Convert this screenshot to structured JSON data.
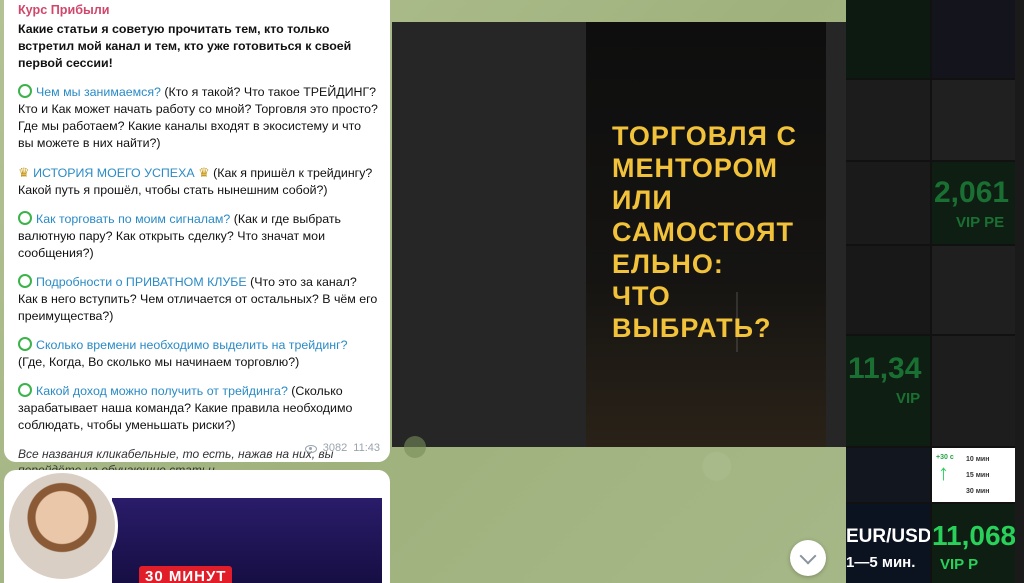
{
  "message": {
    "channel_name": "Курс Прибыли",
    "intro": "Какие статьи я советую прочитать тем, кто только встретил мой канал и тем, кто уже готовиться к своей первой сессии!",
    "items": [
      {
        "link": "Чем мы занимаемся?",
        "text": " (Кто я такой? Что такое ТРЕЙДИНГ? Кто и Как может начать работу со мной? Торговля это просто? Где мы работаем? Какие каналы входят в экосистему и что вы можете в них найти?)",
        "icon": "green-circle-icon"
      },
      {
        "link": "ИСТОРИЯ МОЕГО УСПЕХА",
        "text": " (Как я пришёл к трейдингу? Какой путь я прошёл, чтобы стать нынешним собой?)",
        "icon": "crown-icon"
      },
      {
        "link": "Как торговать по моим сигналам?",
        "text": " (Как и где выбрать валютную пару? Как открыть сделку? Что значат мои сообщения?)",
        "icon": "green-circle-icon"
      },
      {
        "link": "Подробности о ПРИВАТНОМ КЛУБЕ",
        "text": " (Что это за канал? Как в него вступить? Чем отличается от остальных? В чём его преимущества?)",
        "icon": "green-circle-icon"
      },
      {
        "link": "Сколько времени необходимо выделить на трейдинг?",
        "text": " (Где, Когда, Во сколько мы начинаем торговлю?)",
        "icon": "green-circle-icon"
      },
      {
        "link": "Какой доход можно получить от трейдинга?",
        "text": " (Сколько зарабатывает наша команда? Какие правила необходимо соблюдать,  чтобы уменьшать риски?)",
        "icon": "green-circle-icon"
      }
    ],
    "footer": "Все названия кликабельные, то есть, нажав на них, вы перейдёте на обучающие статьи",
    "views": "3082",
    "time": "11:43"
  },
  "video": {
    "title": "30 МИНУТ"
  },
  "viewer": {
    "poster_lines": [
      "ТОРГОВЛЯ С",
      "МЕНТОРОМ",
      "ИЛИ",
      "САМОСТОЯТ",
      "ЕЛЬНО:",
      "ЧТО",
      "ВЫБРАТЬ?"
    ]
  },
  "thumbs": {
    "num1": "2,061",
    "vip1": "VIP PE",
    "num2": "11,34",
    "vip2": "VIP",
    "pair": "EUR/USD",
    "pair_sub": "1—5 мин.",
    "num3": "11,068",
    "vip3": "VIP P",
    "time_options": [
      "10 мин",
      "15 мин",
      "30 мин"
    ],
    "delta": "+30 с"
  },
  "colors": {
    "link": "#2a8bc6",
    "channel": "#d1476b",
    "poster_text": "#f2c23a",
    "accent_green": "#29d15a"
  }
}
